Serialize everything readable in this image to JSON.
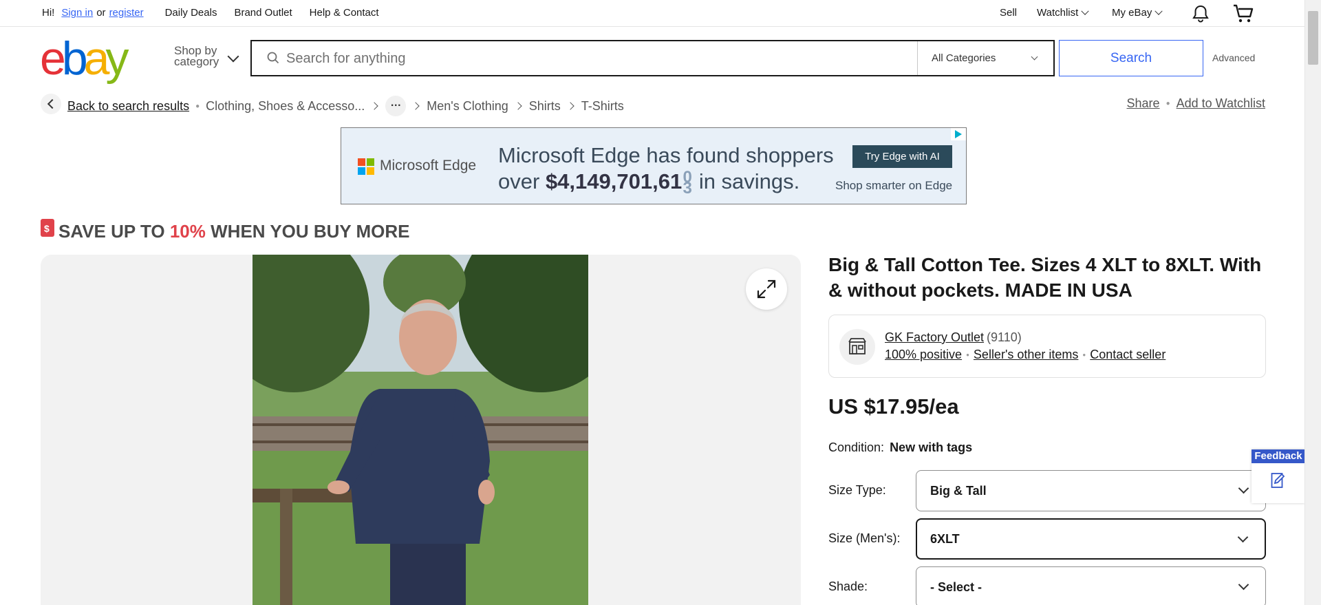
{
  "topnav": {
    "greeting": "Hi!",
    "signin": "Sign in",
    "or": "or",
    "register": "register",
    "daily_deals": "Daily Deals",
    "brand_outlet": "Brand Outlet",
    "help_contact": "Help & Contact",
    "sell": "Sell",
    "watchlist": "Watchlist",
    "my_ebay": "My eBay"
  },
  "header": {
    "logo": [
      "e",
      "b",
      "a",
      "y"
    ],
    "shop_by_line1": "Shop by",
    "shop_by_line2": "category",
    "search_placeholder": "Search for anything",
    "category": "All Categories",
    "search_button": "Search",
    "advanced": "Advanced"
  },
  "breadcrumb": {
    "back": "Back to search results",
    "items": [
      "Clothing, Shoes & Accesso...",
      "Men's Clothing",
      "Shirts",
      "T-Shirts"
    ],
    "more": "…",
    "share": "Share",
    "add_watchlist": "Add to Watchlist"
  },
  "ad": {
    "brand": "Microsoft Edge",
    "line1": "Microsoft Edge has found shoppers",
    "line2_pre": "over",
    "amount": "$4,149,701,61",
    "odometer_top": "0",
    "odometer_bottom": "3",
    "line2_post": "in savings.",
    "cta": "Try Edge with AI",
    "sub": "Shop smarter on Edge",
    "ms_colors": [
      "#f25022",
      "#7fba00",
      "#00a4ef",
      "#ffb900"
    ]
  },
  "promo": {
    "pre": "SAVE UP TO",
    "pct": "10%",
    "post": "WHEN YOU BUY MORE"
  },
  "listing": {
    "title": "Big & Tall Cotton Tee. Sizes 4 XLT to 8XLT. With & without pockets. MADE IN USA",
    "seller_name": "GK Factory Outlet",
    "seller_count": "(9110)",
    "positive": "100% positive",
    "other_items": "Seller's other items",
    "contact": "Contact seller",
    "price": "US $17.95/ea",
    "condition_label": "Condition:",
    "condition_value": "New with tags",
    "size_type_label": "Size Type:",
    "size_type_value": "Big & Tall",
    "size_label": "Size (Men's):",
    "size_value": "6XLT",
    "shade_label": "Shade:",
    "shade_value": "- Select -"
  },
  "feedback": {
    "label": "Feedback"
  },
  "colors": {
    "link_blue": "#3665f3",
    "promo_red": "#e0424a",
    "feedback_blue": "#3558c9"
  }
}
